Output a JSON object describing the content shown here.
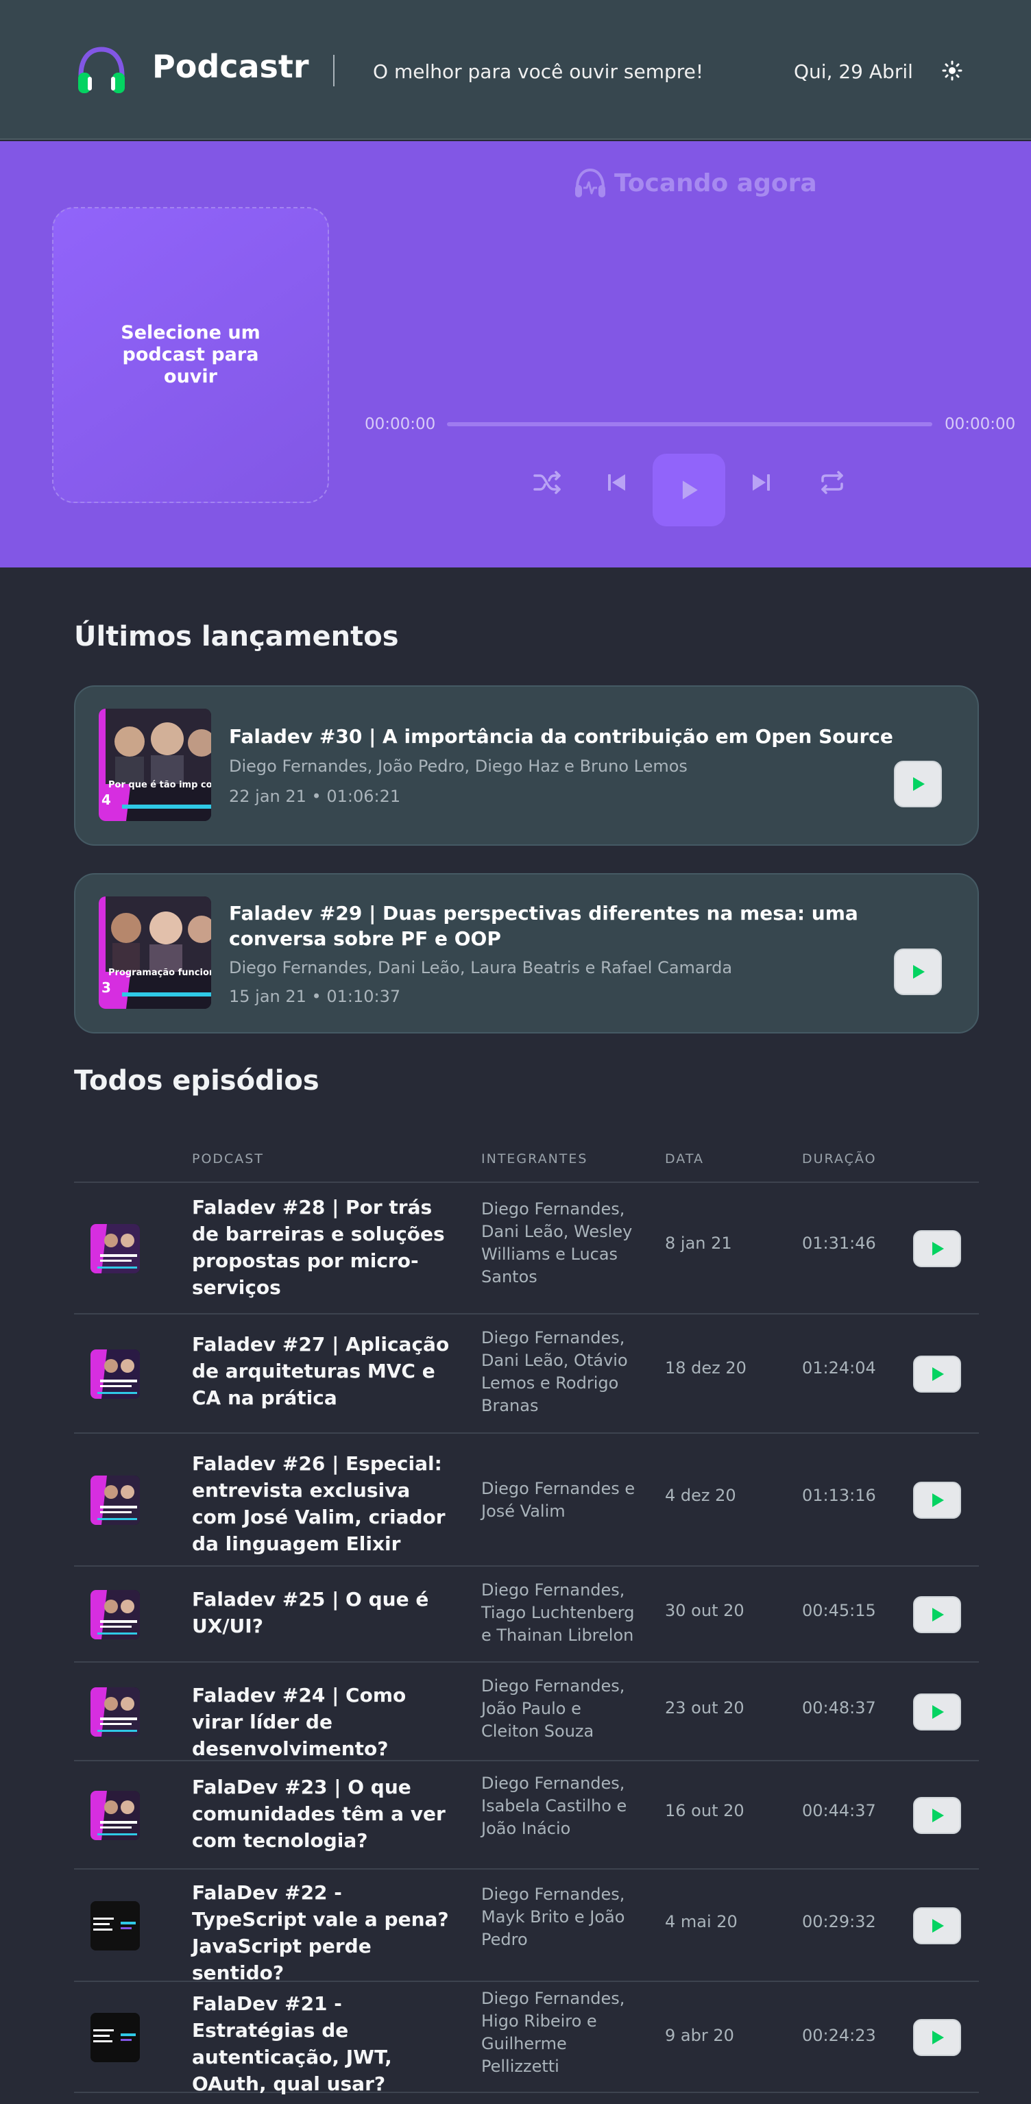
{
  "header": {
    "brand": "Podcastr",
    "tagline": "O melhor para você ouvir sempre!",
    "date": "Qui, 29 Abril"
  },
  "player": {
    "now_playing": "Tocando agora",
    "empty_message": "Selecione um podcast para ouvir",
    "time_start": "00:00:00",
    "time_end": "00:00:00",
    "progress": 0
  },
  "latest": {
    "title": "Últimos lançamentos",
    "episodes": [
      {
        "title": "Faladev #30 | A importância da contribuição em Open Source",
        "members": "Diego Fernandes, João Pedro, Diego Haz e Bruno Lemos",
        "meta": "22 jan 21 • 01:06:21",
        "thumb_caption": "Por que é tão imp contribuir em Open S",
        "thumb_number": "4"
      },
      {
        "title": "Faladev #29 | Duas perspectivas diferentes na mesa: uma conversa sobre PF e OOP",
        "members": "Diego Fernandes, Dani Leão, Laura Beatris e Rafael Camarda",
        "meta": "15 jan 21 • 01:10:37",
        "thumb_caption": "Programação funcion devs orientados a o",
        "thumb_number": "3"
      }
    ]
  },
  "all": {
    "title": "Todos episódios",
    "columns": [
      "PODCAST",
      "INTEGRANTES",
      "DATA",
      "DURAÇÃO"
    ],
    "rows": [
      {
        "title": "Faladev #28 | Por trás de barreiras e soluções propostas por micro-serviços",
        "members": "Diego Fernandes, Dani Leão, Wesley Williams e Lucas Santos",
        "date": "8 jan 21",
        "duration": "01:31:46"
      },
      {
        "title": "Faladev #27 | Aplicação de arquiteturas MVC e CA na prática",
        "members": "Diego Fernandes, Dani Leão, Otávio Lemos e Rodrigo Branas",
        "date": "18 dez 20",
        "duration": "01:24:04"
      },
      {
        "title": "Faladev #26 | Especial: entrevista exclusiva com José Valim, criador da linguagem Elixir",
        "members": "Diego Fernandes e José Valim",
        "date": "4 dez 20",
        "duration": "01:13:16"
      },
      {
        "title": "Faladev #25 | O que é UX/UI?",
        "members": "Diego Fernandes, Tiago Luchtenberg e Thainan Librelon",
        "date": "30 out 20",
        "duration": "00:45:15"
      },
      {
        "title": "Faladev #24 | Como virar líder de desenvolvimento?",
        "members": "Diego Fernandes, João Paulo e Cleiton Souza",
        "date": "23 out 20",
        "duration": "00:48:37"
      },
      {
        "title": "FalaDev #23 | O que comunidades têm a ver com tecnologia?",
        "members": "Diego Fernandes, Isabela Castilho e João Inácio",
        "date": "16 out 20",
        "duration": "00:44:37"
      },
      {
        "title": "FalaDev #22 - TypeScript vale a pena? JavaScript perde sentido?",
        "members": "Diego Fernandes, Mayk Brito e João Pedro",
        "date": "4 mai 20",
        "duration": "00:29:32"
      },
      {
        "title": "FalaDev #21 - Estratégias de autenticação, JWT, OAuth, qual usar?",
        "members": "Diego Fernandes, Higo Ribeiro e Guilherme Pellizzetti",
        "date": "9 abr 20",
        "duration": "00:24:23"
      }
    ]
  },
  "colors": {
    "header_bg": "#37474f",
    "player_bg": "#8257e5",
    "page_bg": "#272a36",
    "card_bg": "#37474f",
    "play_green": "#04d361",
    "thumb_magenta": "#d62ee0"
  },
  "icons": [
    "headphones-logo-icon",
    "sun-icon",
    "shuffle-icon",
    "previous-icon",
    "play-icon",
    "next-icon",
    "repeat-icon"
  ]
}
